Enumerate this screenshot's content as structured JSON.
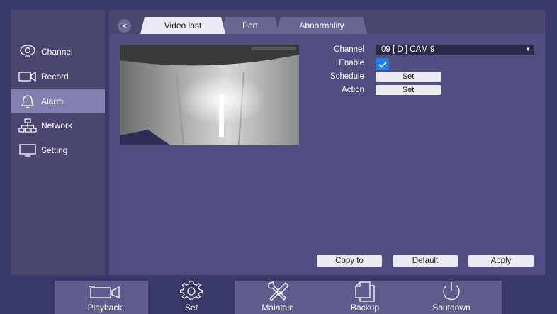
{
  "sidebar": {
    "items": [
      {
        "label": "Channel",
        "icon": "webcam-icon"
      },
      {
        "label": "Record",
        "icon": "video-camera-icon"
      },
      {
        "label": "Alarm",
        "icon": "bell-icon"
      },
      {
        "label": "Network",
        "icon": "network-icon"
      },
      {
        "label": "Setting",
        "icon": "monitor-icon"
      }
    ],
    "active": "Alarm"
  },
  "tabs": {
    "back": "<",
    "items": [
      "Video lost",
      "Port",
      "Abnormality"
    ],
    "active": "Video lost"
  },
  "form": {
    "channel_label": "Channel",
    "channel_value": "09 [ D ] CAM 9",
    "enable_label": "Enable",
    "enable_checked": true,
    "schedule_label": "Schedule",
    "schedule_button": "Set",
    "action_label": "Action",
    "action_button": "Set"
  },
  "actions": {
    "copy_to": "Copy to",
    "default": "Default",
    "apply": "Apply"
  },
  "toolbar": {
    "items": [
      {
        "label": "Playback",
        "icon": "camcorder-icon"
      },
      {
        "label": "Set",
        "icon": "gear-icon"
      },
      {
        "label": "Maintain",
        "icon": "tools-icon"
      },
      {
        "label": "Backup",
        "icon": "copy-icon"
      },
      {
        "label": "Shutdown",
        "icon": "power-icon"
      }
    ],
    "active": "Set"
  },
  "colors": {
    "background": "#3a3769",
    "panel": "#524d80",
    "sidebar": "#4a466f",
    "active_item": "#8380b0",
    "checkbox": "#1e7fe8"
  }
}
